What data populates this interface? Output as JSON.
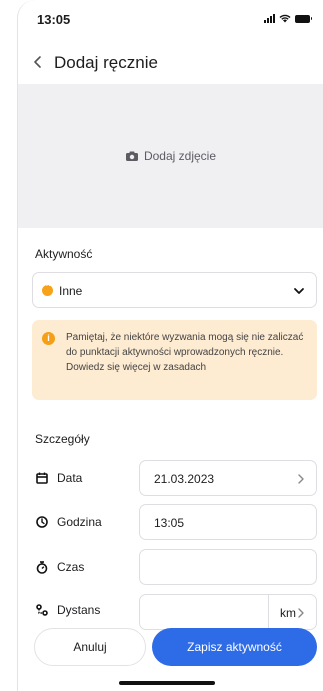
{
  "status": {
    "time": "13:05"
  },
  "header": {
    "title": "Dodaj ręcznie"
  },
  "photo": {
    "label": "Dodaj zdjęcie"
  },
  "activity": {
    "section_label": "Aktywność",
    "selected": "Inne",
    "accent_color": "#f7a21b"
  },
  "notice": {
    "text": "Pamiętaj, że niektóre wyzwania mogą się nie zaliczać do punktacji aktywności wprowadzonych ręcznie. Dowiedz się więcej w zasadach"
  },
  "details": {
    "section_label": "Szczegóły",
    "date": {
      "label": "Data",
      "value": "21.03.2023",
      "icon": "calendar-icon"
    },
    "time": {
      "label": "Godzina",
      "value": "13:05",
      "icon": "clock-icon"
    },
    "duration": {
      "label": "Czas",
      "value": "",
      "icon": "stopwatch-icon"
    },
    "distance": {
      "label": "Dystans",
      "value": "",
      "unit": "km",
      "icon": "route-icon"
    }
  },
  "actions": {
    "cancel_label": "Anuluj",
    "save_label": "Zapisz aktywność",
    "primary_color": "#2e6be6"
  }
}
